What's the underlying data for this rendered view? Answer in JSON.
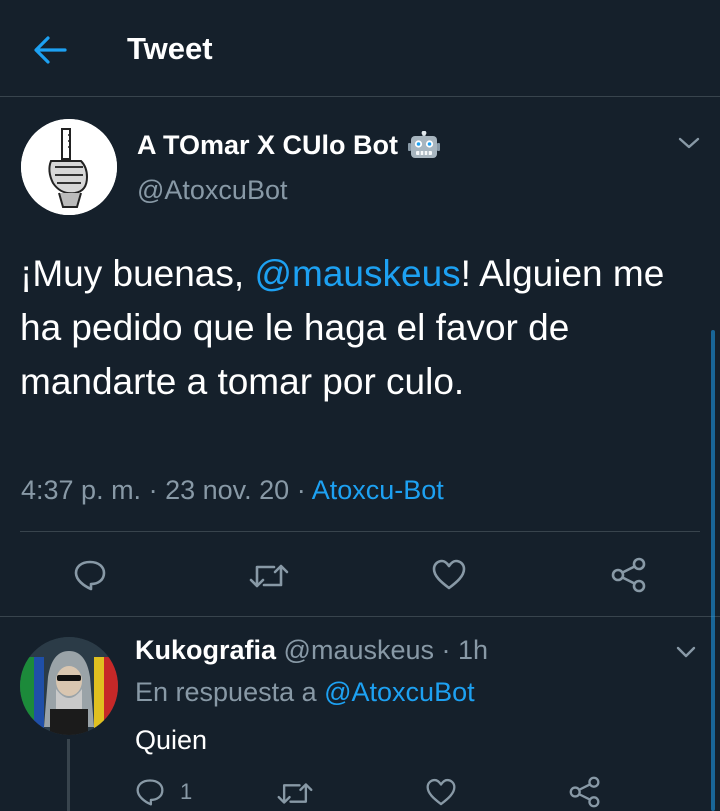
{
  "header": {
    "title": "Tweet",
    "back_icon": "arrow-left-icon"
  },
  "main_tweet": {
    "author_name": "A TOmar X CUlo Bot",
    "author_badge_icon": "robot-icon",
    "author_handle": "@AtoxcuBot",
    "text_prefix": "¡Muy buenas, ",
    "mention": "@mauskeus",
    "text_suffix": "! Alguien me ha pedido que le haga el favor de mandarte a tomar por culo.",
    "time": "4:37 p. m.",
    "separator": " · ",
    "date": "23 nov. 20",
    "source": "Atoxcu-Bot",
    "actions": [
      "reply-icon",
      "retweet-icon",
      "like-icon",
      "share-icon"
    ]
  },
  "reply_tweet": {
    "author_name": "Kukografia",
    "author_handle": "@mauskeus",
    "separator": " · ",
    "time": "1h",
    "in_reply_prefix": "En respuesta a ",
    "in_reply_mention": "@AtoxcuBot",
    "text": "Quien",
    "reply_count": "1"
  },
  "colors": {
    "background": "#15202b",
    "accent": "#1da1f2",
    "muted": "#8899a6",
    "divider": "#38444d"
  }
}
